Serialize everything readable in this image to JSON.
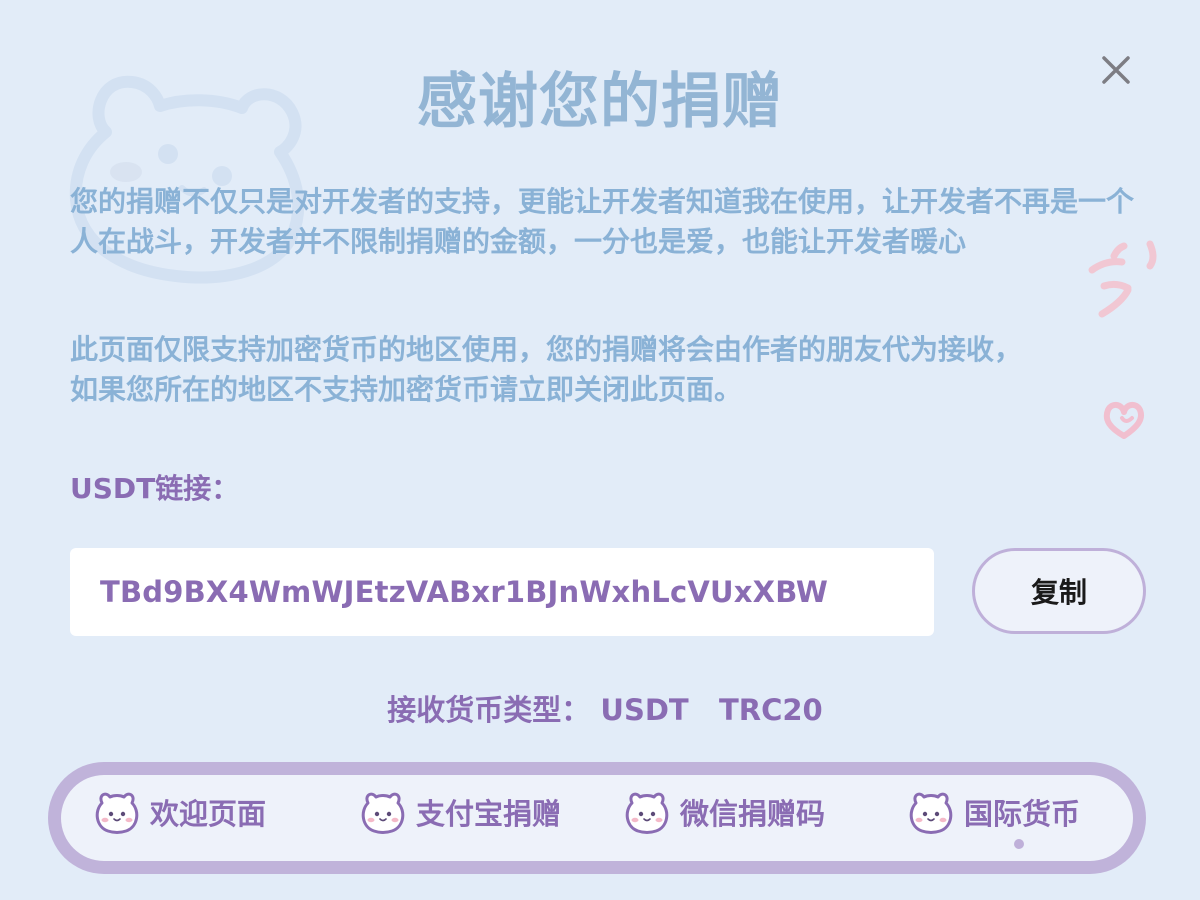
{
  "dialog": {
    "title": "感谢您的捐赠",
    "paragraph1": "您的捐赠不仅只是对开发者的支持，更能让开发者知道我在使用，让开发者不再是一个人在战斗，开发者并不限制捐赠的金额，一分也是爱，也能让开发者暖心",
    "paragraph2_line1": "此页面仅限支持加密货币的地区使用，您的捐赠将会由作者的朋友代为接收，",
    "paragraph2_line2": "如果您所在的地区不支持加密货币请立即关闭此页面。",
    "usdt_label": "USDT链接：",
    "address": "TBd9BX4WmWJEtzVABxr1BJnWxhLcVUxXBW",
    "copy_label": "复制",
    "currency_type_label": "接收货币类型：",
    "currency_value": "USDT   TRC20"
  },
  "nav": {
    "items": [
      {
        "label": "欢迎页面",
        "icon": "bear-icon"
      },
      {
        "label": "支付宝捐赠",
        "icon": "bear-icon"
      },
      {
        "label": "微信捐赠码",
        "icon": "bear-icon"
      },
      {
        "label": "国际货币",
        "icon": "bear-icon",
        "active": true
      }
    ]
  },
  "colors": {
    "background": "#e2ecf8",
    "title": "#93b5d4",
    "body_text": "#8ab2d6",
    "accent_purple": "#8a6cb3",
    "nav_border": "#c0b3da",
    "pink_deco": "#f4c6d2"
  }
}
